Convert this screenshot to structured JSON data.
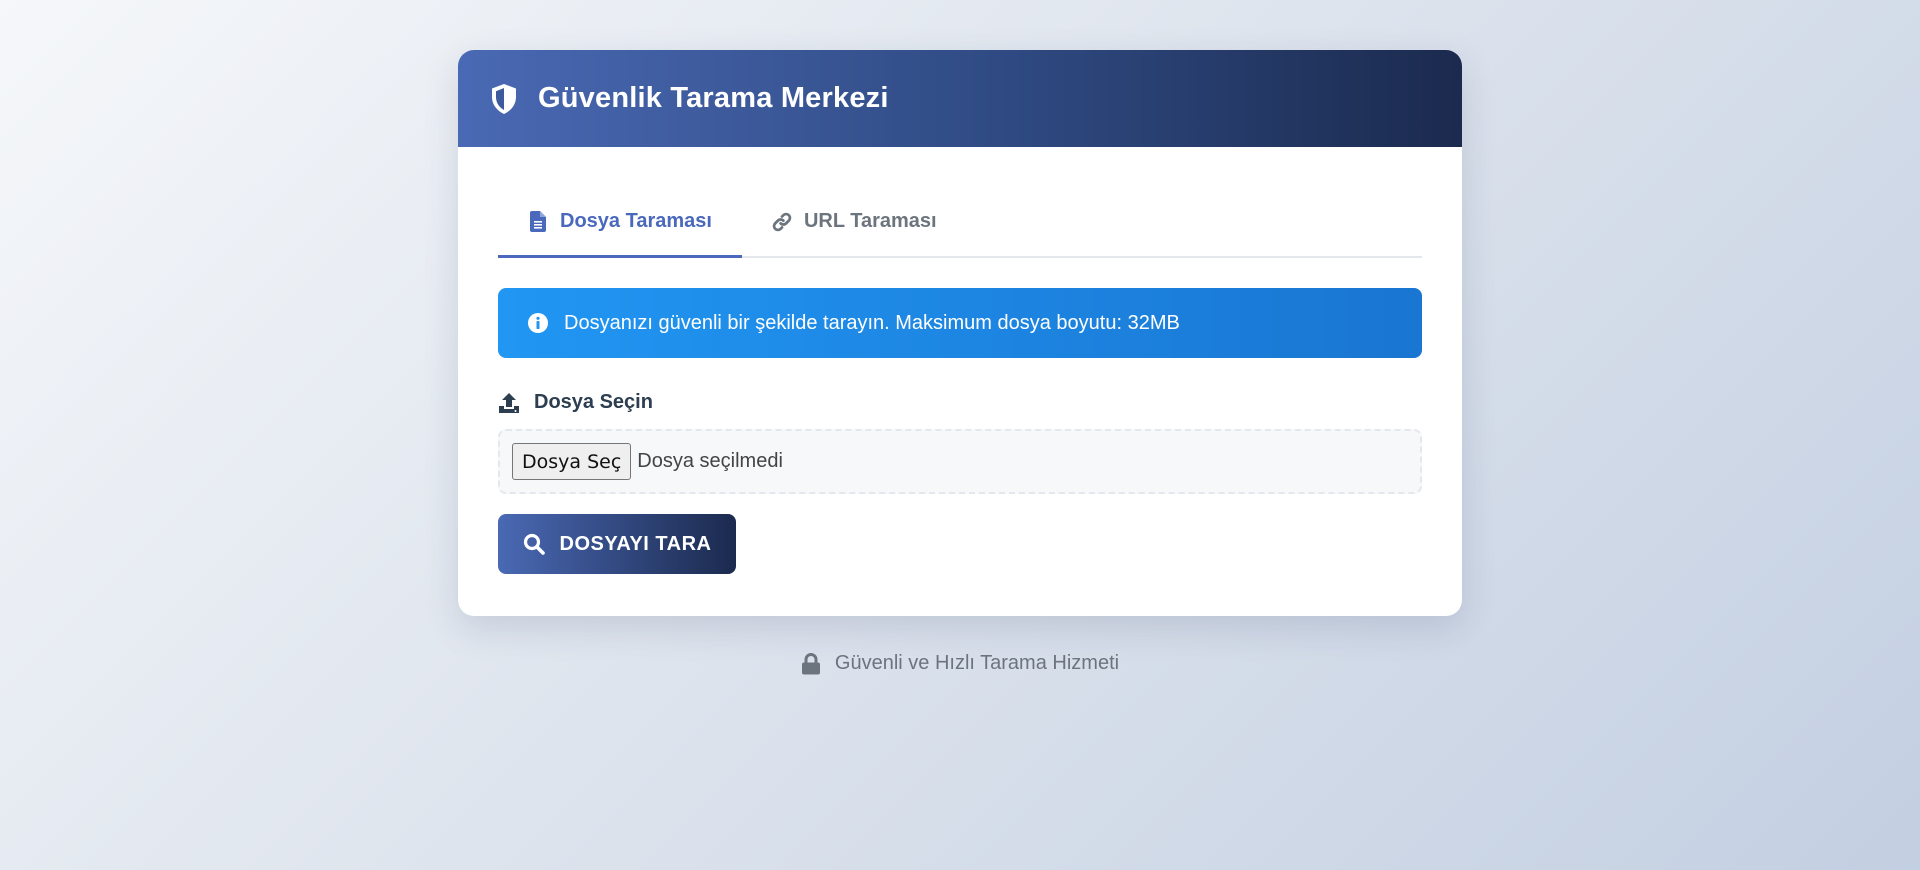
{
  "header": {
    "title": "Güvenlik Tarama Merkezi",
    "icon": "shield-icon"
  },
  "tabs": [
    {
      "label": "Dosya Taraması",
      "icon": "file-icon",
      "active": true
    },
    {
      "label": "URL Taraması",
      "icon": "link-icon",
      "active": false
    }
  ],
  "alert": {
    "icon": "info-icon",
    "text": "Dosyanızı güvenli bir şekilde tarayın. Maksimum dosya boyutu: 32MB"
  },
  "file_field": {
    "label": "Dosya Seçin",
    "icon": "upload-icon",
    "button_label": "Dosya Seç",
    "status": "Dosya seçilmedi"
  },
  "scan_button": {
    "label": "DOSYAYI TARA",
    "icon": "search-icon"
  },
  "footer": {
    "icon": "lock-icon",
    "text": "Güvenli ve Hızlı Tarama Hizmeti"
  },
  "colors": {
    "accent": "#4a69bd",
    "header_start": "#4a69b4",
    "header_end": "#1b2a4e",
    "alert_start": "#2196f3",
    "alert_end": "#1976d2",
    "muted_text": "#6c757d"
  }
}
